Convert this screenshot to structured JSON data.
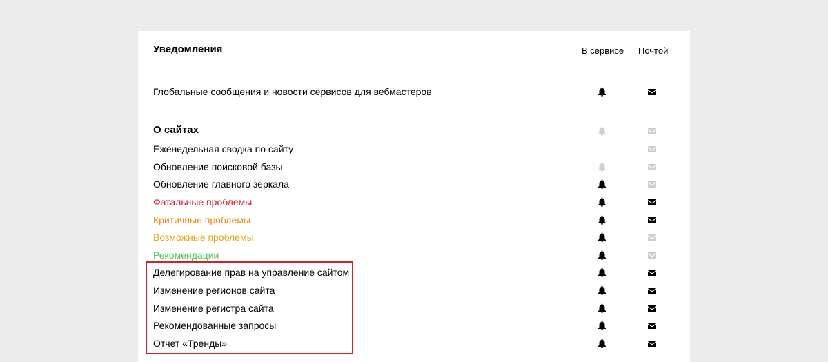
{
  "header": {
    "title": "Уведомления",
    "column_service": "В сервисе",
    "column_mail": "Почтой"
  },
  "colors": {
    "fatal": "#d0202a",
    "critical": "#ee8a16",
    "possible": "#e3a81c",
    "recommendations": "#55c059",
    "highlight_border": "#d4202a",
    "icon_on": "#000000",
    "icon_off": "#cfcfcf"
  },
  "rows": [
    {
      "label": "Глобальные сообщения и новости сервисов для вебмастеров",
      "bell": "on",
      "mail": "on"
    },
    {
      "label": "О сайтах",
      "bell": "off",
      "mail": "off"
    },
    {
      "label": "Еженедельная сводка по сайту",
      "bell": "none",
      "mail": "off"
    },
    {
      "label": "Обновление поисковой базы",
      "bell": "off",
      "mail": "off"
    },
    {
      "label": "Обновление главного зеркала",
      "bell": "on",
      "mail": "off"
    },
    {
      "label": "Фатальные проблемы",
      "bell": "on",
      "mail": "on"
    },
    {
      "label": "Критичные проблемы",
      "bell": "on",
      "mail": "on"
    },
    {
      "label": "Возможные проблемы",
      "bell": "on",
      "mail": "off"
    },
    {
      "label": "Рекомендации",
      "bell": "on",
      "mail": "off"
    },
    {
      "label": "Делегирование прав на управление сайтом",
      "bell": "on",
      "mail": "on"
    },
    {
      "label": "Изменение регионов сайта",
      "bell": "on",
      "mail": "on"
    },
    {
      "label": "Изменение регистра сайта",
      "bell": "on",
      "mail": "on"
    },
    {
      "label": "Рекомендованные запросы",
      "bell": "on",
      "mail": "on"
    },
    {
      "label": "Отчет «Тренды»",
      "bell": "on",
      "mail": "on"
    }
  ]
}
